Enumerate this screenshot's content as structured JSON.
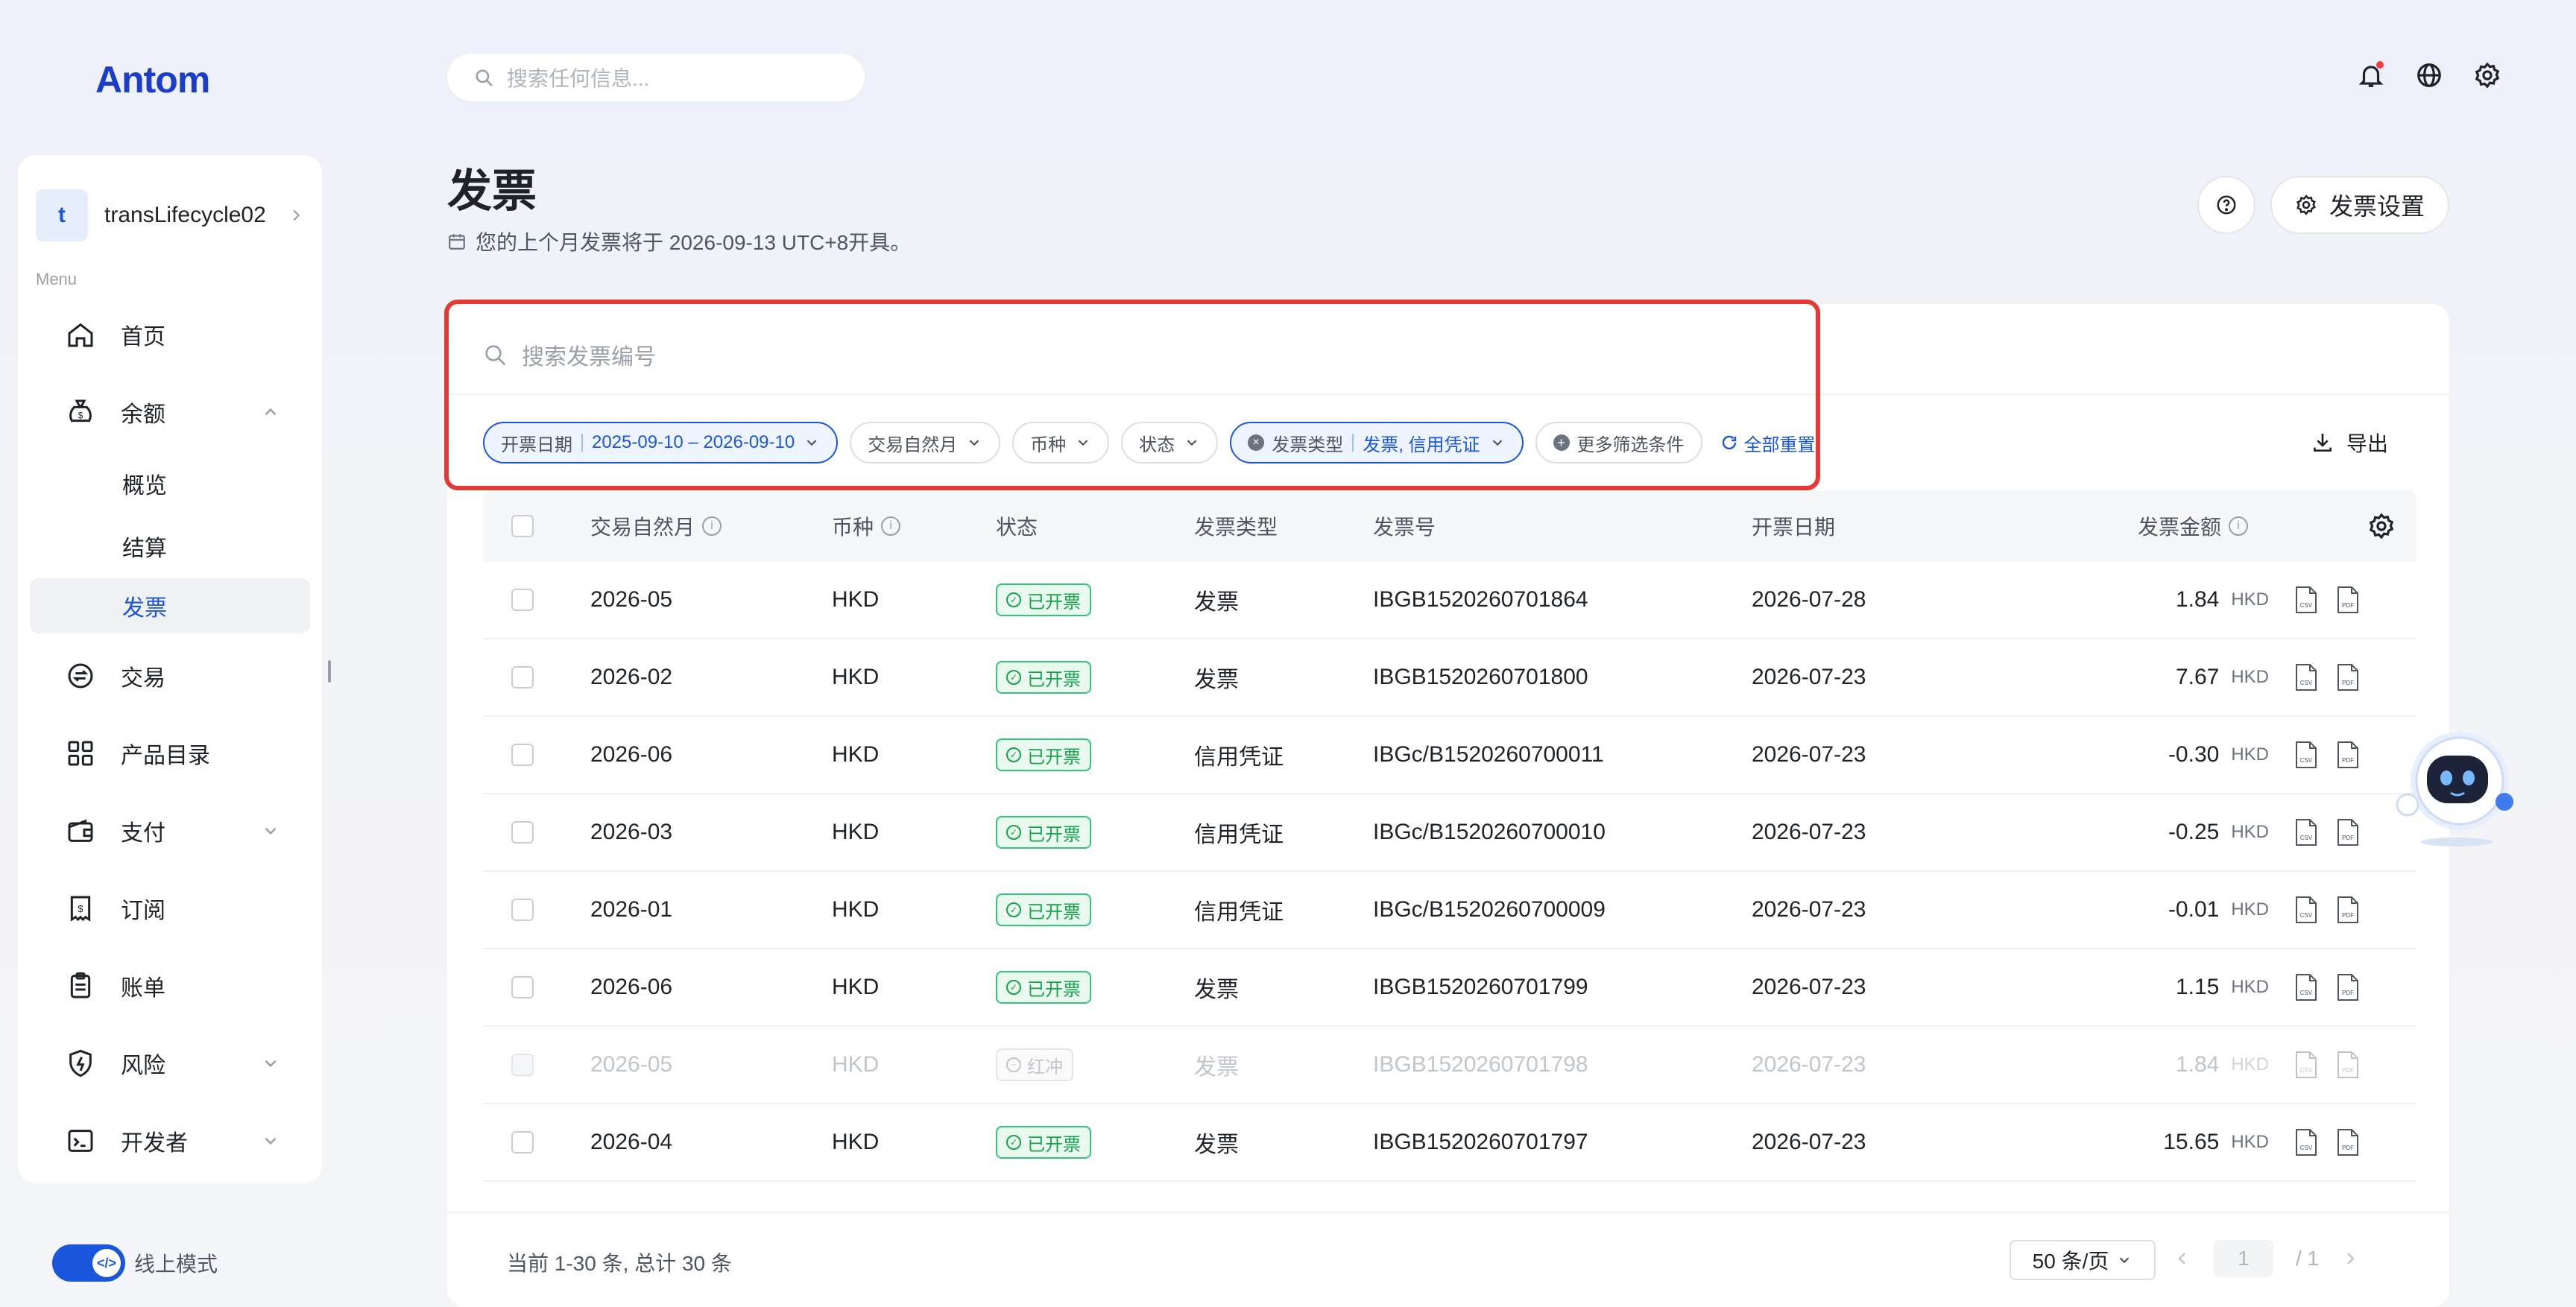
{
  "brand": {
    "logo": "Antom"
  },
  "topbar": {
    "search_placeholder": "搜索任何信息..."
  },
  "sidebar": {
    "account": {
      "initial": "t",
      "name": "transLifecycle02"
    },
    "menu_label": "Menu",
    "items": [
      {
        "label": "首页"
      },
      {
        "label": "余额"
      },
      {
        "label": "交易"
      },
      {
        "label": "产品目录"
      },
      {
        "label": "支付"
      },
      {
        "label": "订阅"
      },
      {
        "label": "账单"
      },
      {
        "label": "风险"
      },
      {
        "label": "开发者"
      }
    ],
    "balance_sub": [
      "概览",
      "结算",
      "发票"
    ],
    "mode_label": "线上模式"
  },
  "page": {
    "title": "发票",
    "subtitle": "您的上个月发票将于 2026-09-13 UTC+8开具。",
    "settings_label": "发票设置"
  },
  "filters": {
    "search_placeholder": "搜索发票编号",
    "invoice_date_label": "开票日期",
    "invoice_date_value": "2025-09-10 – 2026-09-10",
    "natural_month": "交易自然月",
    "currency": "币种",
    "status": "状态",
    "invoice_type_label": "发票类型",
    "invoice_type_value": "发票, 信用凭证",
    "more": "更多筛选条件",
    "reset": "全部重置",
    "export": "导出"
  },
  "table": {
    "columns": [
      "交易自然月",
      "币种",
      "状态",
      "发票类型",
      "发票号",
      "开票日期",
      "发票金额"
    ],
    "rows": [
      {
        "month": "2026-05",
        "currency": "HKD",
        "status": "已开票",
        "type": "发票",
        "number": "IBGB1520260701864",
        "date": "2026-07-28",
        "amount": "1.84",
        "amount_currency": "HKD"
      },
      {
        "month": "2026-02",
        "currency": "HKD",
        "status": "已开票",
        "type": "发票",
        "number": "IBGB1520260701800",
        "date": "2026-07-23",
        "amount": "7.67",
        "amount_currency": "HKD"
      },
      {
        "month": "2026-06",
        "currency": "HKD",
        "status": "已开票",
        "type": "信用凭证",
        "number": "IBGc/B1520260700011",
        "date": "2026-07-23",
        "amount": "-0.30",
        "amount_currency": "HKD"
      },
      {
        "month": "2026-03",
        "currency": "HKD",
        "status": "已开票",
        "type": "信用凭证",
        "number": "IBGc/B1520260700010",
        "date": "2026-07-23",
        "amount": "-0.25",
        "amount_currency": "HKD"
      },
      {
        "month": "2026-01",
        "currency": "HKD",
        "status": "已开票",
        "type": "信用凭证",
        "number": "IBGc/B1520260700009",
        "date": "2026-07-23",
        "amount": "-0.01",
        "amount_currency": "HKD"
      },
      {
        "month": "2026-06",
        "currency": "HKD",
        "status": "已开票",
        "type": "发票",
        "number": "IBGB1520260701799",
        "date": "2026-07-23",
        "amount": "1.15",
        "amount_currency": "HKD"
      },
      {
        "month": "2026-05",
        "currency": "HKD",
        "status": "红冲",
        "type": "发票",
        "number": "IBGB1520260701798",
        "date": "2026-07-23",
        "amount": "1.84",
        "amount_currency": "HKD"
      },
      {
        "month": "2026-04",
        "currency": "HKD",
        "status": "已开票",
        "type": "发票",
        "number": "IBGB1520260701797",
        "date": "2026-07-23",
        "amount": "15.65",
        "amount_currency": "HKD"
      }
    ]
  },
  "footer": {
    "total": "当前 1-30 条, 总计 30 条",
    "page_size": "50 条/页",
    "current_page": "1",
    "total_pages": "/ 1"
  },
  "icons": {
    "top": [
      "bell-icon",
      "globe-icon",
      "gear-icon"
    ],
    "row_docs": [
      "csv-file-icon",
      "pdf-file-icon"
    ]
  },
  "colors": {
    "accent": "#1a56db",
    "success": "#16a34a",
    "highlight_border": "#e53935"
  }
}
